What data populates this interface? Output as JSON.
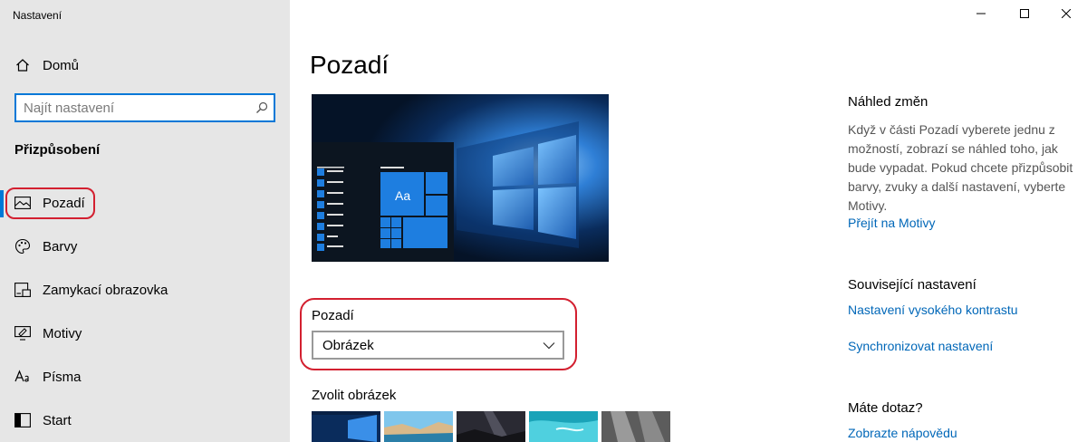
{
  "window": {
    "title": "Nastavení",
    "minimize_icon": "minimize-icon",
    "maximize_icon": "maximize-icon",
    "close_icon": "close-icon"
  },
  "sidebar": {
    "home": {
      "label": "Domů",
      "icon": "home-icon"
    },
    "search": {
      "placeholder": "Najít nastavení",
      "value": "",
      "icon": "search-icon"
    },
    "section": "Přizpůsobení",
    "items": [
      {
        "label": "Pozadí",
        "icon": "picture-icon",
        "active": true
      },
      {
        "label": "Barvy",
        "icon": "palette-icon"
      },
      {
        "label": "Zamykací obrazovka",
        "icon": "lock-screen-icon"
      },
      {
        "label": "Motivy",
        "icon": "themes-icon"
      },
      {
        "label": "Písma",
        "icon": "fonts-icon"
      },
      {
        "label": "Start",
        "icon": "start-icon"
      }
    ]
  },
  "main": {
    "title": "Pozadí",
    "preview": {
      "tile_text": "Aa"
    },
    "background_label": "Pozadí",
    "background_select": {
      "value": "Obrázek",
      "icon": "chevron-down-icon"
    },
    "choose_picture_label": "Zvolit obrázek"
  },
  "right": {
    "preview_heading": "Náhled změn",
    "preview_text": "Když v části Pozadí vyberete jednu z možností, zobrazí se náhled toho, jak bude vypadat. Pokud chcete přizpůsobit barvy, zvuky a další nastavení, vyberte Motivy.",
    "themes_link": "Přejít na Motivy",
    "related_heading": "Související nastavení",
    "high_contrast_link": "Nastavení vysokého kontrastu",
    "sync_link": "Synchronizovat nastavení",
    "question_heading": "Máte dotaz?",
    "help_link": "Zobrazte nápovědu"
  },
  "colors": {
    "accent": "#0078d7",
    "link": "#0067b8",
    "highlight": "#d32030",
    "sidebar_bg": "#e6e6e6"
  }
}
